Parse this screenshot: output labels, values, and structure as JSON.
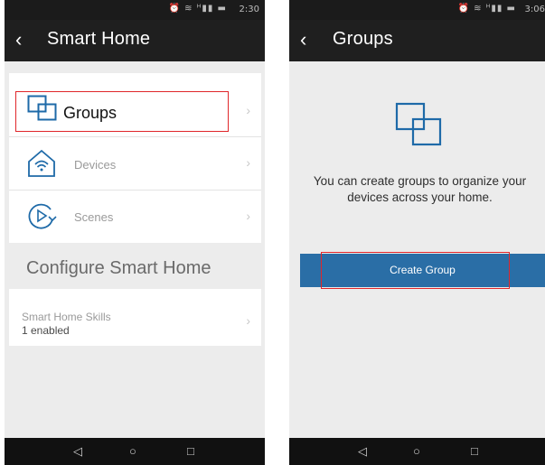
{
  "left": {
    "status": {
      "icons": "⏰ ≋ ᴴ▮▮ ▬",
      "time": "2:30"
    },
    "appbar": {
      "back": "‹",
      "title": "Smart Home"
    },
    "items": [
      {
        "label": "Groups",
        "icon": "groups-icon"
      },
      {
        "label": "Devices",
        "icon": "devices-icon"
      },
      {
        "label": "Scenes",
        "icon": "scenes-icon"
      }
    ],
    "chevron": "›",
    "section_title": "Configure Smart Home",
    "skills": {
      "title": "Smart Home Skills",
      "subtitle": "1 enabled"
    },
    "nav": {
      "back": "◁",
      "home": "○",
      "recents": "□"
    }
  },
  "right": {
    "status": {
      "icons": "⏰ ≋ ᴴ▮▮ ▬",
      "time": "3:06"
    },
    "appbar": {
      "back": "‹",
      "title": "Groups"
    },
    "empty_message": "You can create groups to organize your devices across your home.",
    "create_button": "Create Group",
    "nav": {
      "back": "◁",
      "home": "○",
      "recents": "□"
    }
  },
  "colors": {
    "accent": "#2a6ea6",
    "highlight": "#e0262a",
    "icon_blue": "#1e6aa8"
  }
}
